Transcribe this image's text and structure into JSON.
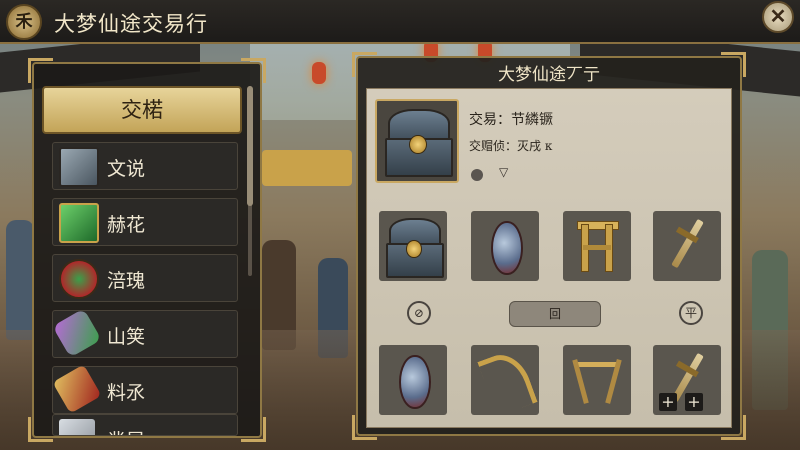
{
  "window": {
    "title": "大梦仙途交易行",
    "logo_glyph": "禾",
    "close_glyph": "✕"
  },
  "left_panel": {
    "header": "交楉",
    "categories": [
      {
        "label": "文说",
        "icon": "gear-chest-icon"
      },
      {
        "label": "赫花",
        "icon": "green-jade-icon"
      },
      {
        "label": "涪瑰",
        "icon": "potion-jar-icon"
      },
      {
        "label": "山䇲",
        "icon": "green-vial-icon"
      },
      {
        "label": "料氶",
        "icon": "red-scroll-icon"
      },
      {
        "label": "丵昆",
        "icon": "misc-item-icon"
      }
    ]
  },
  "right_panel": {
    "title": "大梦仙途丆亍",
    "featured": {
      "line1": "交易：节繗镢",
      "line2": "交赗侦：灭戌 к"
    },
    "row1": [
      {
        "icon": "blue-chest-icon"
      },
      {
        "icon": "spirit-egg-icon"
      },
      {
        "icon": "golden-gate-icon"
      },
      {
        "icon": "wooden-sword-icon"
      }
    ],
    "controls": {
      "left": "⊘",
      "middle": "回",
      "right": "平"
    },
    "row2": [
      {
        "icon": "spirit-egg-icon"
      },
      {
        "icon": "golden-bow-icon"
      },
      {
        "icon": "wooden-stand-icon"
      },
      {
        "icon": "wooden-sword-icon",
        "plus_labels": [
          "+",
          "+"
        ]
      }
    ]
  }
}
